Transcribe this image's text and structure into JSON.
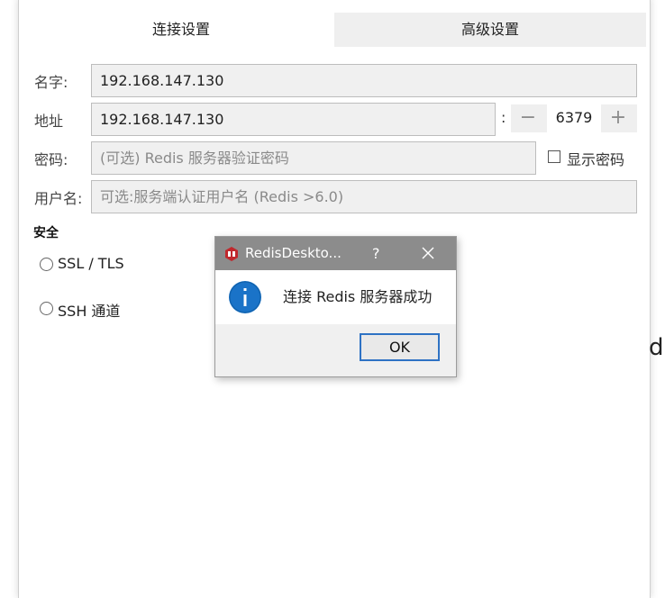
{
  "tabs": {
    "connection": "连接设置",
    "advanced": "高级设置"
  },
  "form": {
    "name": {
      "label": "名字:",
      "value": "192.168.147.130"
    },
    "address": {
      "label": "地址",
      "value": "192.168.147.130",
      "port_sep": ":",
      "port": "6379",
      "minus": "−",
      "plus": "+"
    },
    "password": {
      "label": "密码:",
      "placeholder": "(可选) Redis 服务器验证密码",
      "show_label": "显示密码"
    },
    "username": {
      "label": "用户名:",
      "placeholder": "可选:服务端认证用户名 (Redis >6.0)"
    }
  },
  "security": {
    "title": "安全",
    "options": [
      {
        "label": "SSL / TLS"
      },
      {
        "label": "SSH 通道"
      }
    ]
  },
  "edge_fragment": "d",
  "dialog": {
    "title": "RedisDeskto...",
    "help": "?",
    "message": "连接 Redis 服务器成功",
    "ok": "OK",
    "app_icon": "redis-icon",
    "message_icon": "info-icon",
    "colors": {
      "titlebar": "#8c8c8c",
      "info": "#1a73c8",
      "ok_border": "#2e72c4",
      "app_icon": "#c0282d"
    }
  }
}
